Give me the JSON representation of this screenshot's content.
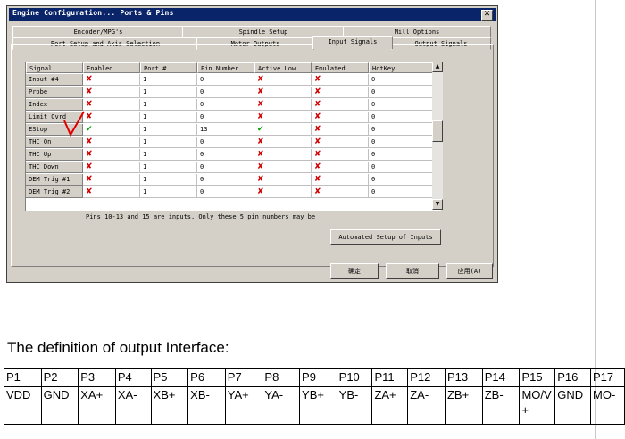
{
  "window": {
    "title": "Engine Configuration... Ports & Pins",
    "close_glyph": "✕"
  },
  "tabs_back": [
    "Encoder/MPG's",
    "Spindle Setup",
    "Mill Options"
  ],
  "tabs_front": [
    "Port Setup and Axis Selection",
    "Motor Outputs",
    "Input Signals",
    "Output Signals"
  ],
  "active_tab": "Input Signals",
  "grid": {
    "columns": [
      "Signal",
      "Enabled",
      "Port #",
      "Pin Number",
      "Active Low",
      "Emulated",
      "HotKey"
    ],
    "rows": [
      {
        "signal": "Input #4",
        "enabled": "✘",
        "port": "1",
        "pin": "0",
        "active_low": "✘",
        "emulated": "✘",
        "hotkey": "0"
      },
      {
        "signal": "Probe",
        "enabled": "✘",
        "port": "1",
        "pin": "0",
        "active_low": "✘",
        "emulated": "✘",
        "hotkey": "0"
      },
      {
        "signal": "Index",
        "enabled": "✘",
        "port": "1",
        "pin": "0",
        "active_low": "✘",
        "emulated": "✘",
        "hotkey": "0"
      },
      {
        "signal": "Limit Ovrd",
        "enabled": "✘",
        "port": "1",
        "pin": "0",
        "active_low": "✘",
        "emulated": "✘",
        "hotkey": "0"
      },
      {
        "signal": "EStop",
        "enabled": "✔",
        "port": "1",
        "pin": "13",
        "active_low": "✔",
        "emulated": "✘",
        "hotkey": "0"
      },
      {
        "signal": "THC On",
        "enabled": "✘",
        "port": "1",
        "pin": "0",
        "active_low": "✘",
        "emulated": "✘",
        "hotkey": "0"
      },
      {
        "signal": "THC Up",
        "enabled": "✘",
        "port": "1",
        "pin": "0",
        "active_low": "✘",
        "emulated": "✘",
        "hotkey": "0"
      },
      {
        "signal": "THC Down",
        "enabled": "✘",
        "port": "1",
        "pin": "0",
        "active_low": "✘",
        "emulated": "✘",
        "hotkey": "0"
      },
      {
        "signal": "OEM Trig #1",
        "enabled": "✘",
        "port": "1",
        "pin": "0",
        "active_low": "✘",
        "emulated": "✘",
        "hotkey": "0"
      },
      {
        "signal": "OEM Trig #2",
        "enabled": "✘",
        "port": "1",
        "pin": "0",
        "active_low": "✘",
        "emulated": "✘",
        "hotkey": "0"
      }
    ]
  },
  "note": "Pins 10-13 and 15 are inputs. Only these 5 pin numbers may be",
  "buttons": {
    "automated_setup": "Automated Setup of Inputs",
    "ok": "确定",
    "cancel": "取消",
    "apply": "应用(A)"
  },
  "doc": {
    "heading": "The definition of output Interface:",
    "pins": [
      "P1",
      "P2",
      "P3",
      "P4",
      "P5",
      "P6",
      "P7",
      "P8",
      "P9",
      "P10",
      "P11",
      "P12",
      "P13",
      "P14",
      "P15",
      "P16",
      "P17"
    ],
    "signals": [
      "VDD",
      "GND",
      "XA+",
      "XA-",
      "XB+",
      "XB-",
      "YA+",
      "YA-",
      "YB+",
      "YB-",
      "ZA+",
      "ZA-",
      "ZB+",
      "ZB-",
      "MO/V+",
      "GND",
      "MO-"
    ]
  },
  "colors": {
    "titlebar": "#0a246a",
    "dialog_face": "#d4d0c8",
    "x_mark": "#d10000",
    "check_mark": "#00a000",
    "red_annotation": "#e00000"
  }
}
